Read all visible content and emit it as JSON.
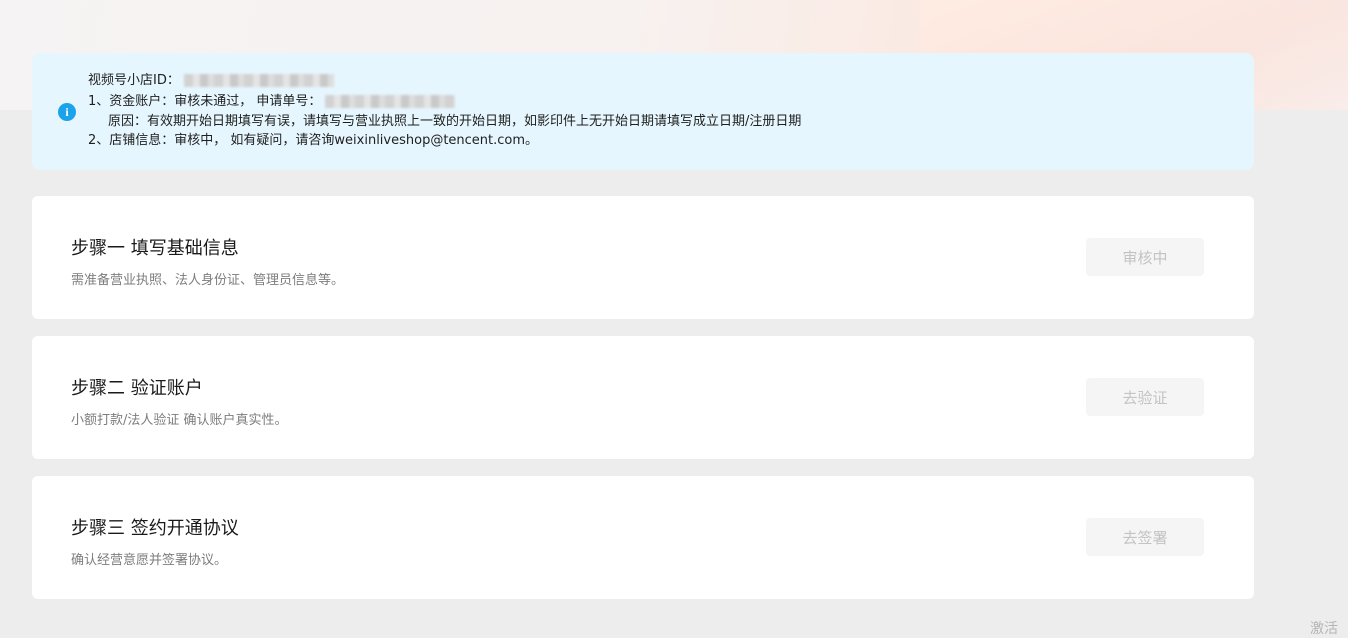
{
  "notice": {
    "shop_id_label": "视频号小店ID：",
    "account_line": "1、资金账户：审核未通过， 申请单号：",
    "reason_line": "原因：有效期开始日期填写有误，请填写与营业执照上一致的开始日期，如影印件上无开始日期请填写成立日期/注册日期",
    "shop_line": "2、店铺信息：审核中， 如有疑问，请咨询weixinliveshop@tencent.com。"
  },
  "steps": [
    {
      "title": "步骤一 填写基础信息",
      "desc": "需准备营业执照、法人身份证、管理员信息等。",
      "button": "审核中"
    },
    {
      "title": "步骤二 验证账户",
      "desc": "小额打款/法人验证 确认账户真实性。",
      "button": "去验证"
    },
    {
      "title": "步骤三 签约开通协议",
      "desc": "确认经营意愿并签署协议。",
      "button": "去签署"
    }
  ],
  "corner_text": "激活",
  "colors": {
    "notice_bg": "#e6f6fe",
    "info_icon": "#1aa3ea",
    "page_bg": "#ededed"
  }
}
